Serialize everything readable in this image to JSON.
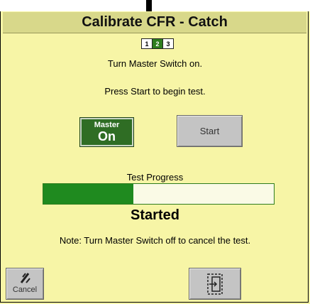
{
  "title": "Calibrate CFR - Catch",
  "steps": {
    "items": [
      "1",
      "2",
      "3"
    ],
    "active_index": 1
  },
  "instructions": {
    "line1": "Turn Master Switch on.",
    "line2": "Press Start to begin test."
  },
  "master_indicator": {
    "label": "Master",
    "state": "On"
  },
  "start_button": {
    "label": "Start"
  },
  "progress": {
    "label": "Test Progress",
    "fraction": 0.39,
    "status": "Started"
  },
  "note": "Note: Turn Master Switch off to cancel the test.",
  "footer": {
    "cancel_label": "Cancel",
    "cancel_icon": "cancel-slash-icon",
    "exit_icon": "exit-door-icon"
  },
  "colors": {
    "background": "#f7f5a6",
    "title_bar": "#d8d88a",
    "accent_green": "#1f8a1f",
    "master_green": "#2f6d24",
    "button_gray": "#c4c4c4"
  }
}
